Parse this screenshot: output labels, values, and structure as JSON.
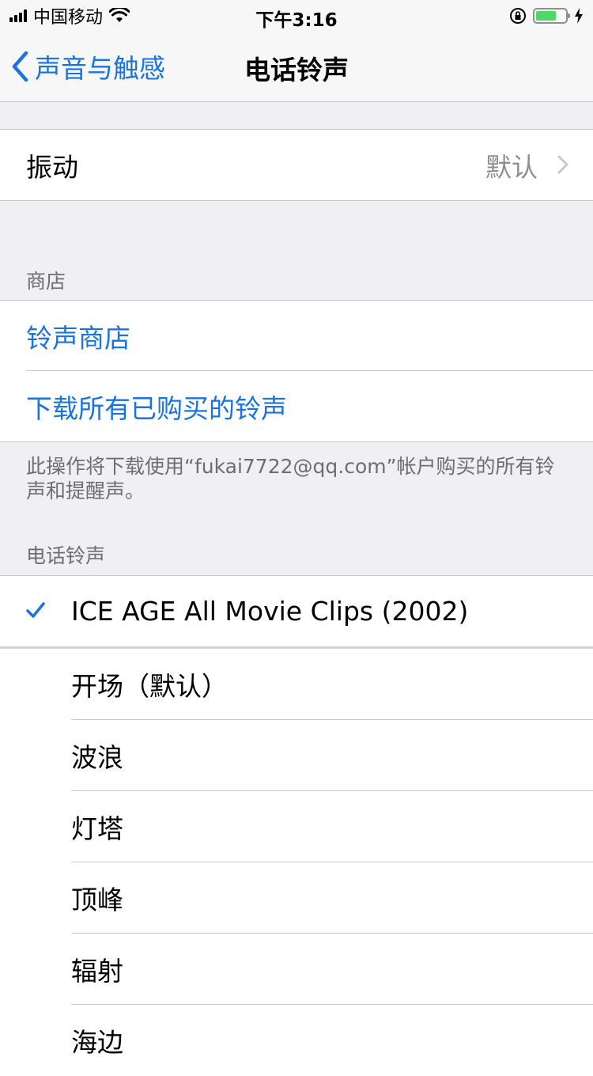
{
  "status_bar": {
    "carrier": "中国移动",
    "time": "下午3:16"
  },
  "nav": {
    "back_label": "声音与触感",
    "title": "电话铃声"
  },
  "vibration": {
    "label": "振动",
    "value": "默认"
  },
  "store_section": {
    "header": "商店",
    "items": [
      "铃声商店",
      "下载所有已购买的铃声"
    ],
    "footer": "此操作将下载使用“fukai7722@qq.com”帐户购买的所有铃声和提醒声。"
  },
  "ringtones_section": {
    "header": "电话铃声",
    "selected": "ICE AGE All Movie Clips (2002)",
    "items": [
      "开场（默认）",
      "波浪",
      "灯塔",
      "顶峰",
      "辐射",
      "海边"
    ]
  },
  "colors": {
    "accent": "#1a74e0",
    "background": "#efeff4",
    "battery": "#4cd964"
  },
  "icons": {
    "back": "chevron-left-icon",
    "disclosure": "chevron-right-icon",
    "check": "checkmark-icon",
    "wifi": "wifi-icon",
    "lock": "orientation-lock-icon",
    "charging": "bolt-icon"
  }
}
